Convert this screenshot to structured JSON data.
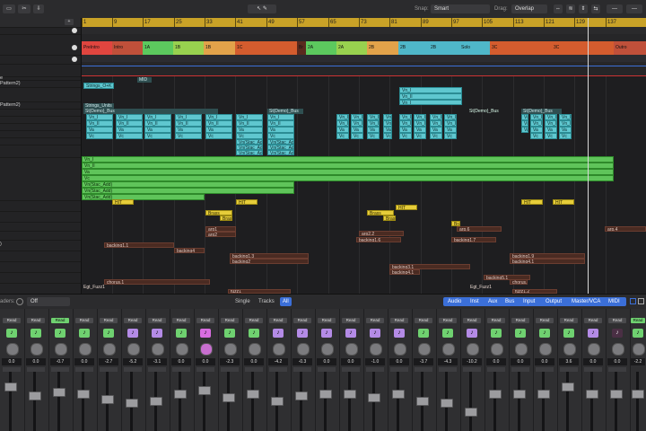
{
  "toolbar": {
    "snap_label": "Snap:",
    "snap_value": "Smart",
    "drag_label": "Drag:",
    "drag_value": "Overlap"
  },
  "ruler": {
    "bars": [
      "1",
      "9",
      "17",
      "25",
      "33",
      "41",
      "49",
      "57",
      "65",
      "73",
      "81",
      "89",
      "97",
      "105",
      "113",
      "121",
      "129",
      "137"
    ]
  },
  "arrangement": {
    "markers": [
      {
        "label": "PreIntro",
        "color": "#e0453f"
      },
      {
        "label": "Intro",
        "color": "#c0503a"
      },
      {
        "label": "1A",
        "color": "#5cc95e"
      },
      {
        "label": "1B",
        "color": "#98d14f"
      },
      {
        "label": "1B",
        "color": "#e2a24a"
      },
      {
        "label": "1C",
        "color": "#d45c2e"
      },
      {
        "label": "Br",
        "color": "#5a2a1e"
      },
      {
        "label": "2A",
        "color": "#5cc95e"
      },
      {
        "label": "2A",
        "color": "#98d14f"
      },
      {
        "label": "2B",
        "color": "#e2a24a"
      },
      {
        "label": "2B",
        "color": "#4fb7c9"
      },
      {
        "label": "2B",
        "color": "#4fb7c9"
      },
      {
        "label": "Solo",
        "color": "#4fb7c9"
      },
      {
        "label": "3C",
        "color": "#d45c2e"
      },
      {
        "label": "3C",
        "color": "#d45c2e"
      },
      {
        "label": "Outro",
        "color": "#c0503a"
      }
    ]
  },
  "tracks": {
    "names": [
      "e",
      "Pattern2)",
      "",
      "Pattern2)",
      "",
      "",
      "",
      "",
      "",
      "",
      "",
      "",
      "",
      "",
      "",
      "",
      "",
      "",
      "",
      ")",
      "",
      "",
      "",
      "",
      ""
    ]
  },
  "regions": {
    "strings_o": "Strings_O+K",
    "strings_units": "Strings_Units",
    "st_demo_bus": "St(Demo)_Bus",
    "st_bus_label": "St(Demo)_Bus",
    "vn1": "Vn_I",
    "vn2": "Vn_II",
    "va": "Va",
    "vc": "Vc",
    "vn_stac": "Vn(Stac_Add)",
    "b": "Brass",
    "arp1": "arp1",
    "arp2": "arp2",
    "arp22": "arp2.2",
    "arp4": "arp.4",
    "arp6": "arp.6",
    "backing11": "backing1.1",
    "backing13": "backing1.3",
    "backing2": "backing2",
    "backing17": "backing1.7",
    "backing16": "backing1.6",
    "backing19": "backing1.9",
    "backing3": "backing3.1",
    "backing41": "backing4.1",
    "backing51": "backing5.1",
    "backing4": "backing4",
    "chorus": "chorus.1",
    "egt_fuzz": "Egt_Fuzz1",
    "fuzz1": "fuzz1",
    "fuzz12": "fuzz1.2",
    "hit": "HIT",
    "mid": "MID"
  },
  "mixer_bar": {
    "faders_label": "aders:",
    "faders_value": "Off",
    "tabs_left": [
      "Single",
      "Tracks",
      "All"
    ],
    "tabs_right": [
      "Audio",
      "Inst",
      "Aux",
      "Bus",
      "Input",
      "Output",
      "Master/VCA",
      "MIDI"
    ]
  },
  "mixer": {
    "read_label": "Read",
    "strips": [
      {
        "vol": "0.0",
        "color": "#6fd170",
        "icon": "♪"
      },
      {
        "vol": "0.0",
        "color": "#6fd170",
        "icon": "♪"
      },
      {
        "vol": "-0.7",
        "color": "#6fd170",
        "icon": "♪"
      },
      {
        "vol": "0.0",
        "color": "#6fd170",
        "icon": "♪"
      },
      {
        "vol": "-2.7",
        "color": "#6fd170",
        "icon": "♪"
      },
      {
        "vol": "-5.2",
        "color": "#b48be6",
        "icon": "♪"
      },
      {
        "vol": "-3.1",
        "color": "#b48be6",
        "icon": "♪"
      },
      {
        "vol": "0.0",
        "color": "#6fd170",
        "icon": "♪"
      },
      {
        "vol": "0.0",
        "color": "#d86de0",
        "icon": "♪"
      },
      {
        "vol": "-2.3",
        "color": "#6fd170",
        "icon": "♪"
      },
      {
        "vol": "0.0",
        "color": "#6fd170",
        "icon": "♪"
      },
      {
        "vol": "-4.2",
        "color": "#b48be6",
        "icon": "♪"
      },
      {
        "vol": "-0.3",
        "color": "#b48be6",
        "icon": "♪"
      },
      {
        "vol": "0.0",
        "color": "#b48be6",
        "icon": "♪"
      },
      {
        "vol": "0.0",
        "color": "#b48be6",
        "icon": "♪"
      },
      {
        "vol": "-1.0",
        "color": "#b48be6",
        "icon": "♪"
      },
      {
        "vol": "0.0",
        "color": "#b48be6",
        "icon": "♪"
      },
      {
        "vol": "-3.7",
        "color": "#6fd170",
        "icon": "♪"
      },
      {
        "vol": "-4.3",
        "color": "#6fd170",
        "icon": "♪"
      },
      {
        "vol": "-10.2",
        "color": "#b48be6",
        "icon": "♪"
      },
      {
        "vol": "0.0",
        "color": "#6fd170",
        "icon": "♪"
      },
      {
        "vol": "0.0",
        "color": "#6fd170",
        "icon": "♪"
      },
      {
        "vol": "0.0",
        "color": "#6fd170",
        "icon": "♪"
      },
      {
        "vol": "3.6",
        "color": "#6fd170",
        "icon": "♪"
      },
      {
        "vol": "0.0",
        "color": "#b48be6",
        "icon": "♪"
      },
      {
        "vol": "-2.2",
        "color": "#6fd170",
        "icon": "♪"
      }
    ]
  },
  "colors": {
    "accent": "#3b6fd8",
    "ruler": "#c9a227",
    "teal": "#5fc7cf",
    "green": "#5fc45a",
    "yellow": "#e6cd3a"
  }
}
